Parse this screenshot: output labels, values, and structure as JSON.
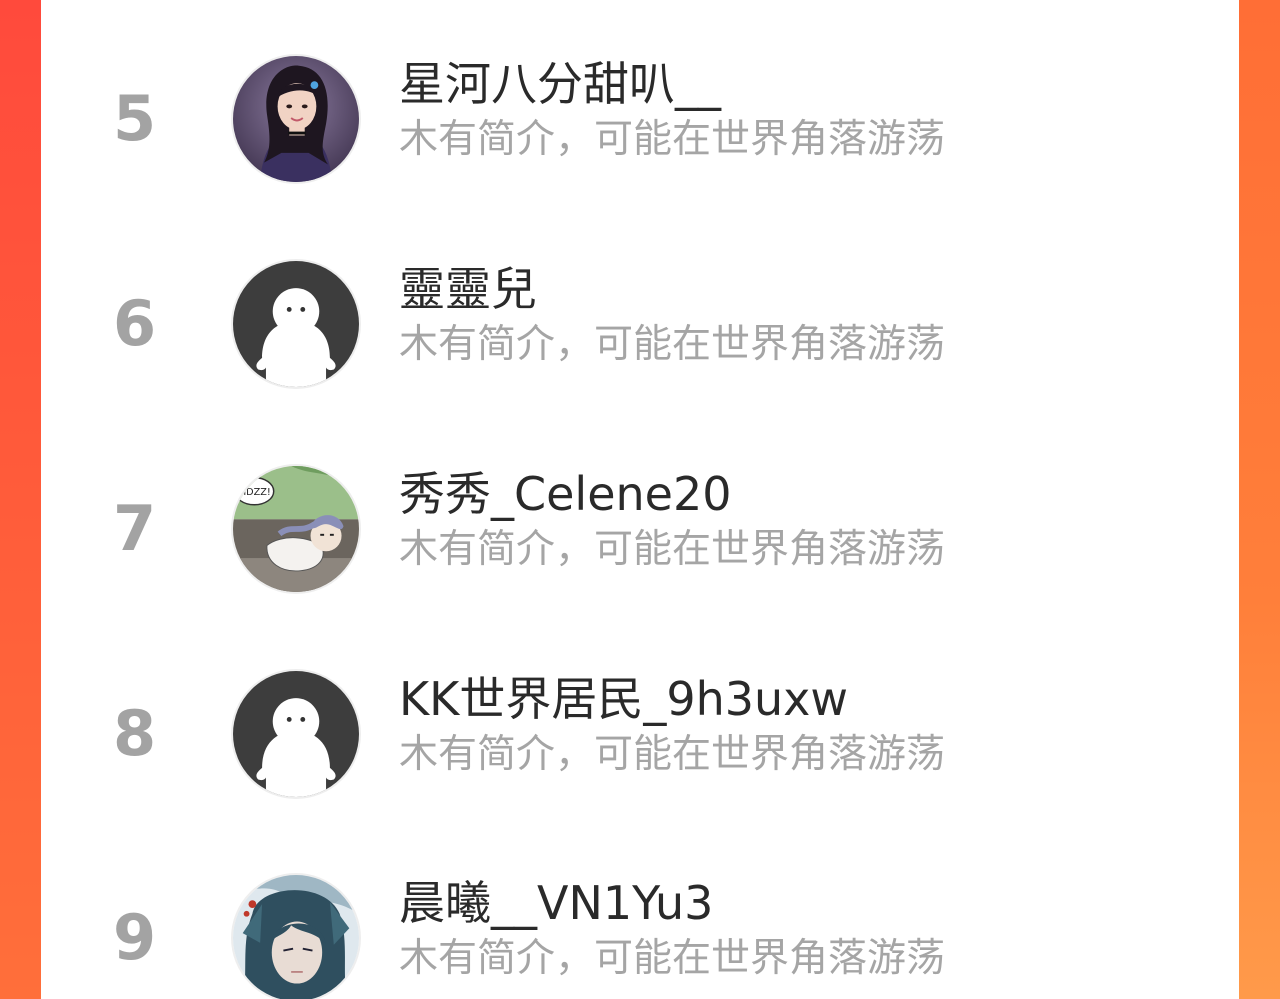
{
  "colors": {
    "background_left": "#ff4a3c",
    "background_right": "#ff7f3a",
    "card": "#ffffff",
    "rank_number": "#a3a3a3",
    "name_text": "#2a2a2a",
    "bio_text": "#a5a5a5",
    "default_avatar_bg": "#3d3d3d"
  },
  "ranking": {
    "entries": [
      {
        "rank": "5",
        "name": "星河八分甜叭__",
        "bio": "木有简介，可能在世界角落游荡",
        "avatar_icon": "girl-photo-avatar-icon"
      },
      {
        "rank": "6",
        "name": "靈靈兒",
        "bio": "木有简介，可能在世界角落游荡",
        "avatar_icon": "default-avatar-icon"
      },
      {
        "rank": "7",
        "name": "秀秀_Celene20",
        "bio": "木有简介，可能在世界角落游荡",
        "avatar_icon": "anime-sleeping-avatar-icon"
      },
      {
        "rank": "8",
        "name": "KK世界居民_9h3uxw",
        "bio": "木有简介，可能在世界角落游荡",
        "avatar_icon": "default-avatar-icon"
      },
      {
        "rank": "9",
        "name": "晨曦__VN1Yu3",
        "bio": "木有简介，可能在世界角落游荡",
        "avatar_icon": "anime-character-avatar-icon"
      }
    ],
    "avatar_speech_bubble_text": "MDZZ!"
  }
}
